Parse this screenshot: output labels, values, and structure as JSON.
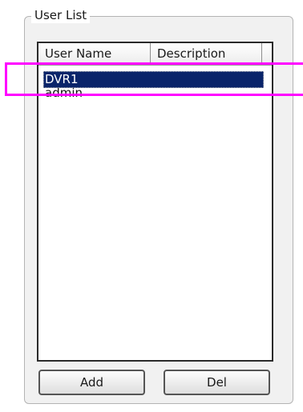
{
  "group": {
    "title": "User List"
  },
  "list": {
    "columns": [
      "User Name",
      "Description"
    ],
    "rows": [
      {
        "name": "DVR1",
        "description": "",
        "selected": true
      },
      {
        "name": "admin",
        "description": "",
        "selected": false
      }
    ]
  },
  "buttons": {
    "add_label": "Add",
    "del_label": "Del"
  },
  "colors": {
    "selection": "#0a246a",
    "highlight": "#ff00ff"
  }
}
